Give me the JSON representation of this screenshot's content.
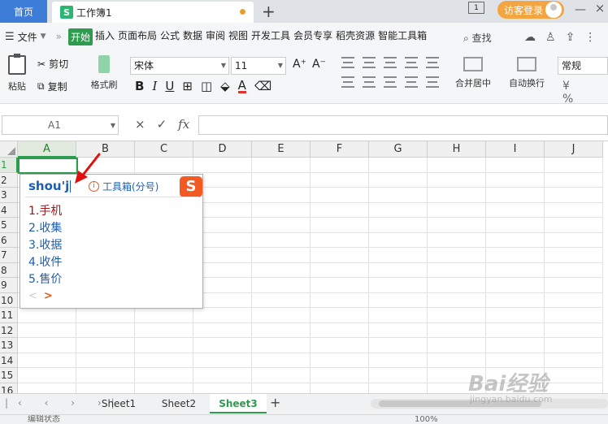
{
  "titlebar": {
    "home_tab": "首页",
    "doc_tab": "工作簿1",
    "doc_icon": "S",
    "new_tab": "+",
    "page_count": "1",
    "login_label": "访客登录",
    "min_icon": "—",
    "close_icon": "×"
  },
  "menubar": {
    "hamburger": "☰",
    "file": "文件",
    "more": "»",
    "items": [
      "开始",
      "插入",
      "页面布局",
      "公式",
      "数据",
      "审阅",
      "视图",
      "开发工具",
      "会员专享",
      "稻壳资源",
      "智能工具箱"
    ],
    "search": "查找"
  },
  "ribbon": {
    "paste": "粘贴",
    "cut": "剪切",
    "copy": "复制",
    "format_painter": "格式刷",
    "font_name": "宋体",
    "font_size": "11",
    "grow_font": "A⁺",
    "shrink_font": "A⁻",
    "bold": "B",
    "italic": "I",
    "underline": "U",
    "font_color": "A",
    "merge_center": "合并居中",
    "wrap_text": "自动换行",
    "number_format": "常规",
    "num_icons": "¥ %",
    "accent_color": "#2e9c4f"
  },
  "formula_bar": {
    "cell_ref": "A1",
    "cancel": "×",
    "confirm": "✓",
    "fx": "fx",
    "formula": ""
  },
  "grid": {
    "columns": [
      "A",
      "B",
      "C",
      "D",
      "E",
      "F",
      "G",
      "H",
      "I",
      "J"
    ],
    "rows": [
      "1",
      "2",
      "3",
      "4",
      "5",
      "6",
      "7",
      "8",
      "9",
      "10",
      "11",
      "12",
      "13",
      "14",
      "15",
      "16"
    ],
    "active_col": "A",
    "active_row": "1"
  },
  "ime": {
    "pinyin": "shou'j",
    "toolbox_label": "工具箱(分号)",
    "info_icon": "i",
    "logo": "S",
    "candidates": [
      "1.手机",
      "2.收集",
      "3.收据",
      "4.收件",
      "5.售价"
    ],
    "prev": "<",
    "next": ">"
  },
  "sheetbar": {
    "nav": "|‹ ‹ › ›|",
    "tabs": [
      "Sheet1",
      "Sheet2",
      "Sheet3"
    ],
    "active_tab": "Sheet3",
    "add": "+"
  },
  "statusbar": {
    "mode": "编辑状态",
    "zoom": "100%"
  },
  "watermark": {
    "main": "Bai经验",
    "sub": "jingyan.baidu.com"
  }
}
